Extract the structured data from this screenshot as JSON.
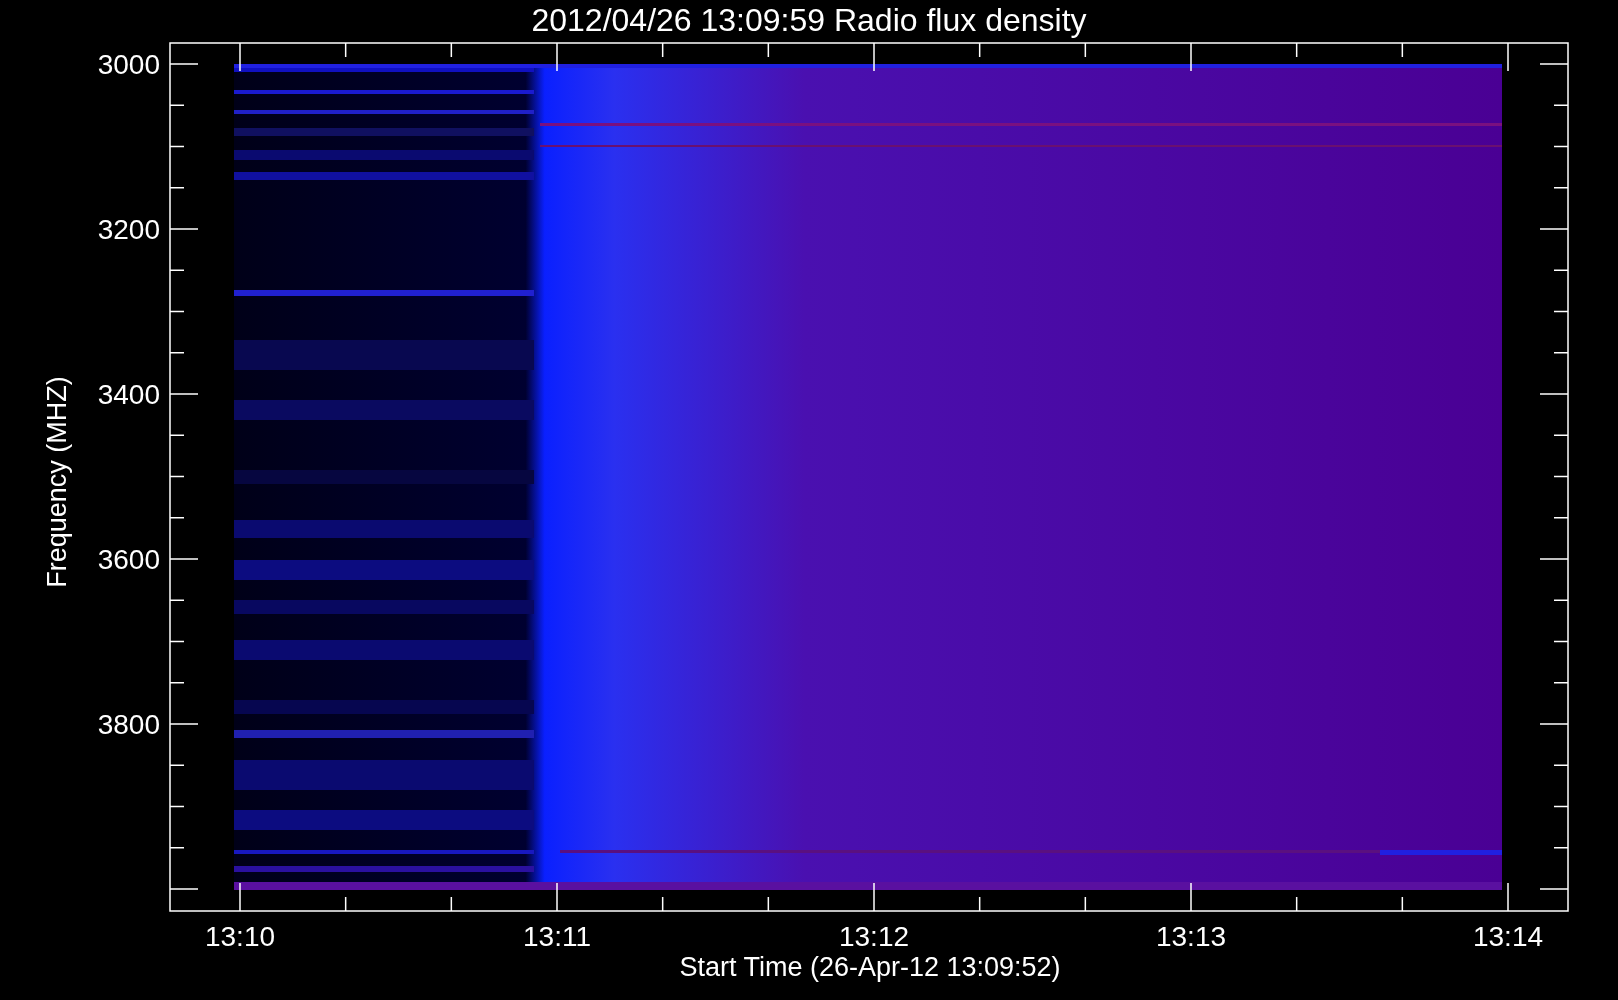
{
  "title": "2012/04/26 13:09:59 Radio flux density",
  "y_axis": {
    "label": "Frequency (MHZ)",
    "ticks": [
      "3000",
      "3200",
      "3400",
      "3600",
      "3800"
    ]
  },
  "x_axis": {
    "label": "Start Time (26-Apr-12 13:09:52)",
    "ticks": [
      "13:10",
      "13:11",
      "13:12",
      "13:13",
      "13:14"
    ]
  }
}
